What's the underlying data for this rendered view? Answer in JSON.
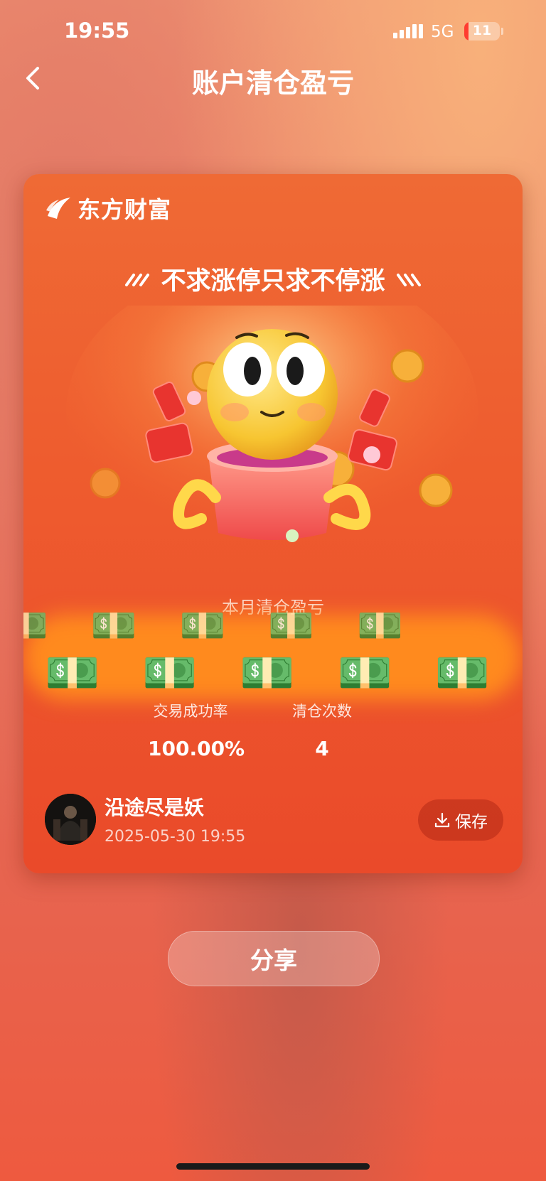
{
  "status_bar": {
    "time": "19:55",
    "network": "5G",
    "battery": "11",
    "battery_level": 0.11
  },
  "nav": {
    "title": "账户清仓盈亏",
    "back_icon": "chevron-left-icon"
  },
  "card": {
    "brand_name": "东方财富",
    "slogan": "不求涨停只求不停涨",
    "month_label": "本月清仓盈亏",
    "stats": [
      {
        "label": "交易成功率",
        "value": "100.00%"
      },
      {
        "label": "清仓次数",
        "value": "4"
      }
    ],
    "user": {
      "name": "沿途尽是妖",
      "datetime": "2025-05-30 19:55"
    },
    "save_label": "保存"
  },
  "share_label": "分享",
  "colors": {
    "accent": "#ee5b2e",
    "band": "#ff8a1e",
    "emoji_yellow": "#f7c531"
  }
}
